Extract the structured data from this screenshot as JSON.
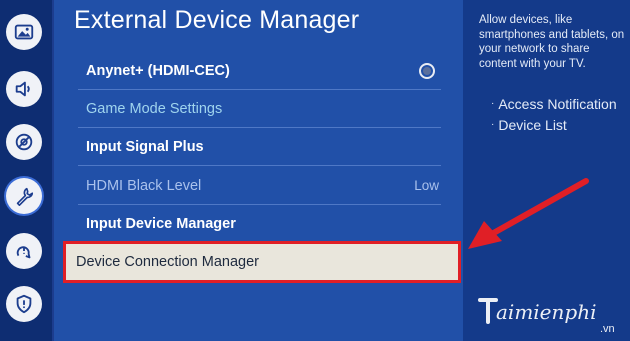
{
  "page_title": "External Device Manager",
  "sidebar": {
    "items": [
      {
        "icon": "picture-icon",
        "active": false
      },
      {
        "icon": "sound-icon",
        "active": false
      },
      {
        "icon": "broadcast-icon",
        "active": false
      },
      {
        "icon": "wrench-icon",
        "active": true
      },
      {
        "icon": "support-icon",
        "active": false
      },
      {
        "icon": "shield-icon",
        "active": false
      }
    ]
  },
  "menu": {
    "items": [
      {
        "label": "Anynet+ (HDMI-CEC)",
        "style": "bold",
        "control": "toggle-dot"
      },
      {
        "label": "Game Mode Settings",
        "style": "teal"
      },
      {
        "label": "Input Signal Plus",
        "style": "bold"
      },
      {
        "label": "HDMI Black Level",
        "style": "dim",
        "value": "Low"
      },
      {
        "label": "Input Device Manager",
        "style": "bold"
      },
      {
        "label": "Device Connection Manager",
        "style": "selected"
      }
    ]
  },
  "help": {
    "description": "Allow devices, like smartphones and tablets, on your network to share content with your TV.",
    "bullets": [
      "Access Notification",
      "Device List"
    ]
  },
  "watermark": {
    "text": "aimienphi",
    "suffix": ".vn"
  },
  "colors": {
    "highlight_border": "#e01f26",
    "selected_row_bg": "#e9e6dc",
    "panel_bg": "#2150a8"
  }
}
